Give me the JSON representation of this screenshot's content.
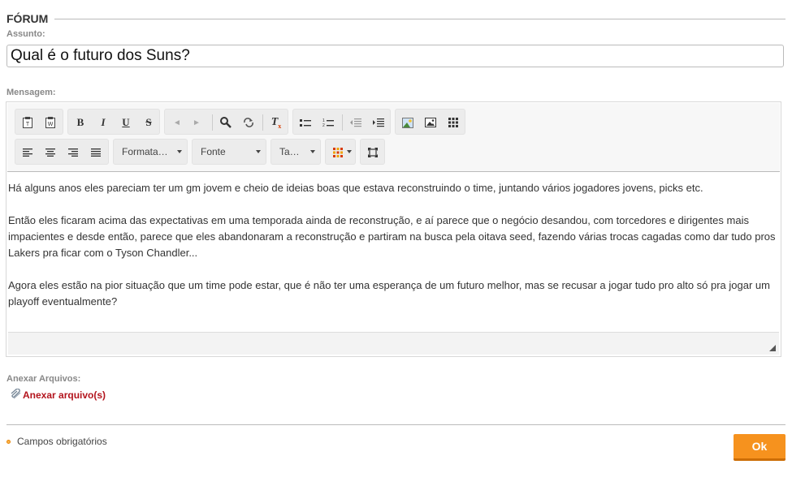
{
  "forum": {
    "section_title": "FÓRUM",
    "subject_label": "Assunto:",
    "subject_value": "Qual é o futuro dos Suns?",
    "message_label": "Mensagem:"
  },
  "toolbar": {
    "row1": [
      {
        "name": "paste-text-icon"
      },
      {
        "name": "paste-word-icon"
      },
      {
        "name": "bold-icon",
        "glyph": "B"
      },
      {
        "name": "italic-icon",
        "glyph": "I"
      },
      {
        "name": "underline-icon",
        "glyph": "U"
      },
      {
        "name": "strikethrough-icon",
        "glyph": "S"
      },
      {
        "name": "undo-icon"
      },
      {
        "name": "redo-icon"
      },
      {
        "name": "find-icon"
      },
      {
        "name": "replace-icon"
      },
      {
        "name": "remove-format-icon"
      },
      {
        "name": "bulleted-list-icon"
      },
      {
        "name": "numbered-list-icon"
      },
      {
        "name": "outdent-icon"
      },
      {
        "name": "indent-icon"
      },
      {
        "name": "image-icon"
      },
      {
        "name": "image-upload-icon"
      },
      {
        "name": "table-icon"
      }
    ],
    "format_label": "Formata…",
    "font_label": "Fonte",
    "size_label": "Ta…",
    "text_color": "#d83b01"
  },
  "editor": {
    "paragraphs": [
      "Há alguns anos eles pareciam ter um gm jovem e cheio de ideias boas que estava reconstruindo o time, juntando vários jogadores jovens, picks etc.",
      "Então eles ficaram acima das expectativas em uma temporada ainda de reconstrução, e aí parece que o negócio desandou, com torcedores e dirigentes mais impacientes e desde então, parece que eles abandonaram a reconstrução e partiram na busca pela oitava seed, fazendo várias trocas cagadas como dar tudo pros Lakers pra ficar com o Tyson Chandler...",
      "Agora eles estão na pior situação que um time pode estar, que é não ter uma esperança de um futuro melhor, mas se recusar a jogar tudo pro alto só pra jogar um playoff eventualmente?"
    ]
  },
  "attachments": {
    "label": "Anexar Arquivos:",
    "link": "Anexar arquivo(s)"
  },
  "footer": {
    "required_note": "Campos obrigatórios",
    "ok_label": "Ok"
  },
  "colors": {
    "accent": "#f6921e",
    "link": "#b3141d",
    "required_dot": "#fbb44a"
  }
}
